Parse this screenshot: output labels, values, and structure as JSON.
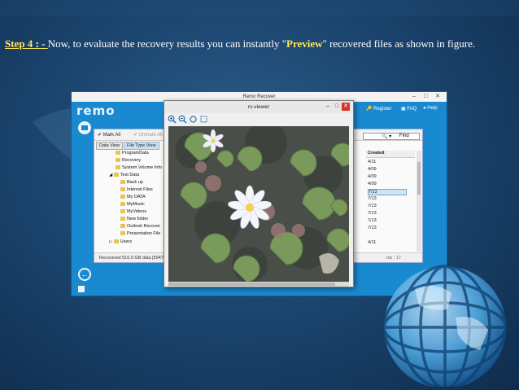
{
  "slide": {
    "step_label": "Step 4",
    "step_sep": " : - ",
    "text_before": " Now, to evaluate the recovery results you can instantly \"",
    "keyword": "Preview",
    "text_after": "\" recovered files as shown in figure."
  },
  "remo_window": {
    "title": "Remo Recover",
    "logo": "remo",
    "header_links": {
      "register": "Register",
      "faq": "FAQ",
      "help": "Help"
    },
    "toolbar": {
      "mark_all": "Mark All",
      "unmark_all": "Unmark All",
      "find": "Find"
    },
    "tabs": [
      "Data View",
      "File Type View"
    ],
    "tree": [
      "ProgramData",
      "Recovery",
      "System Volume Info",
      "Test Data",
      "Back up",
      "Internet Files",
      "My DATA",
      "MyMusic",
      "MyVideos",
      "New folder",
      "Outlook Recover",
      "Presentation File",
      "Users"
    ],
    "column_header": "Created",
    "column_values": [
      "4/11",
      "4/09",
      "4/09",
      "4/09",
      "7/13",
      "7/13",
      "7/13",
      "7/13",
      "7/13",
      "7/13",
      "4/11"
    ],
    "status_left": "Recovered 510.0 GB data [5947",
    "status_right": "ms : 17"
  },
  "viewer": {
    "title": "rs-viewer",
    "tools": [
      "zoom-in-icon",
      "zoom-out-icon",
      "rotate-icon",
      "fit-icon"
    ]
  },
  "colors": {
    "background": "#1c4670",
    "accent_yellow": "#ffe85a",
    "remo_blue": "#1a8ad0"
  }
}
